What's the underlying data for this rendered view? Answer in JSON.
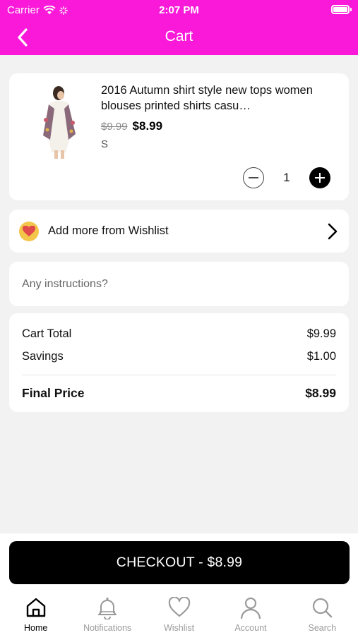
{
  "status": {
    "carrier": "Carrier",
    "time": "2:07 PM"
  },
  "nav": {
    "title": "Cart"
  },
  "product": {
    "title": "2016 Autumn shirt style new tops women blouses printed shirts casu…",
    "old_price": "$9.99",
    "price": "$8.99",
    "size": "S",
    "quantity": "1"
  },
  "wishlist": {
    "label": "Add more from Wishlist"
  },
  "instructions": {
    "placeholder": "Any instructions?",
    "value": ""
  },
  "totals": {
    "cart_total_label": "Cart Total",
    "cart_total_value": "$9.99",
    "savings_label": "Savings",
    "savings_value": "$1.00",
    "final_label": "Final Price",
    "final_value": "$8.99"
  },
  "checkout": {
    "label": "CHECKOUT - $8.99"
  },
  "tabs": [
    {
      "label": "Home",
      "icon": "home-icon",
      "active": true
    },
    {
      "label": "Notifications",
      "icon": "bell-icon",
      "active": false
    },
    {
      "label": "Wishlist",
      "icon": "heart-icon",
      "active": false
    },
    {
      "label": "Account",
      "icon": "user-icon",
      "active": false
    },
    {
      "label": "Search",
      "icon": "search-icon",
      "active": false
    }
  ],
  "colors": {
    "brand": "#fa19d9",
    "checkout_bg": "#000000",
    "wishlist_badge": "#f3c64a"
  }
}
